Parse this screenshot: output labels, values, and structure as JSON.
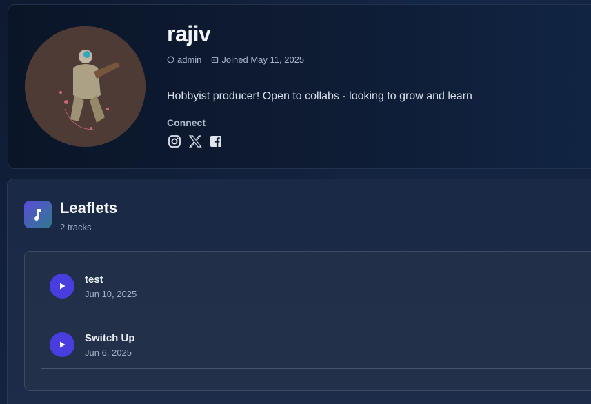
{
  "profile": {
    "username": "rajiv",
    "role": "admin",
    "joined": "Joined May 11, 2025",
    "bio": "Hobbyist producer! Open to collabs - looking to grow and learn",
    "connect_label": "Connect",
    "socials": [
      {
        "name": "instagram-icon"
      },
      {
        "name": "x-icon"
      },
      {
        "name": "facebook-icon"
      }
    ]
  },
  "album": {
    "title": "Leaflets",
    "track_count": "2 tracks",
    "icon": "music-note-icon",
    "tracks": [
      {
        "title": "test",
        "date": "Jun 10, 2025"
      },
      {
        "title": "Switch Up",
        "date": "Jun 6, 2025"
      }
    ]
  },
  "colors": {
    "accent": "#4a3de0",
    "background": "#101a2e"
  }
}
